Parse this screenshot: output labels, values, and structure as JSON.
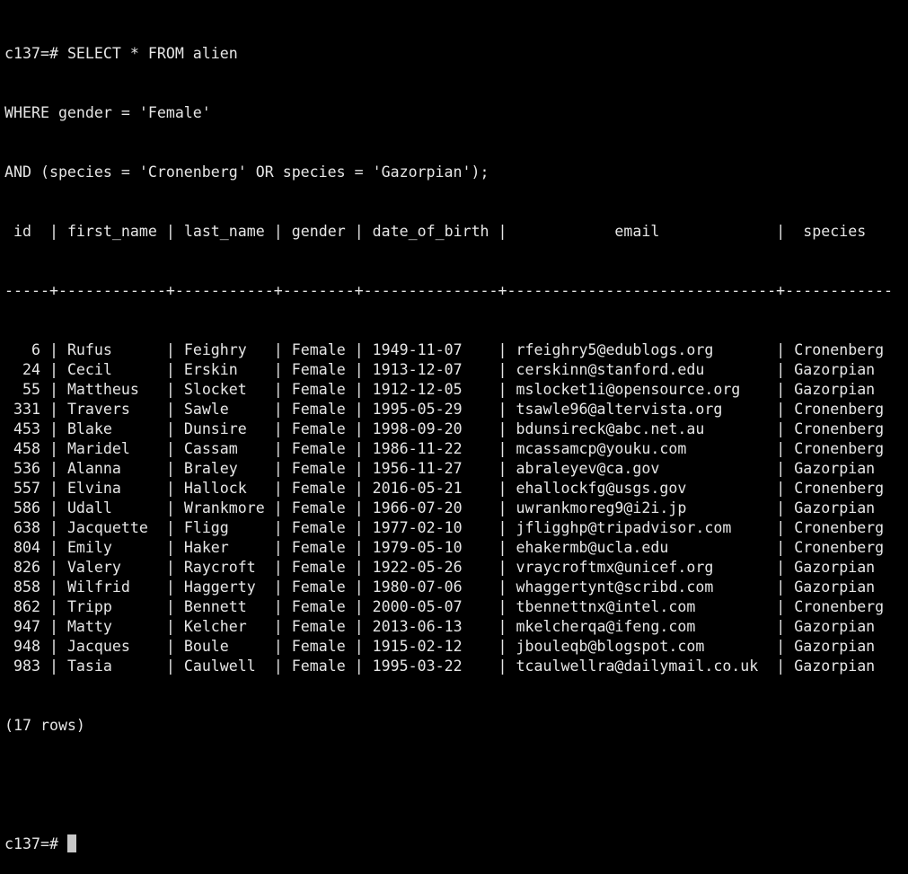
{
  "terminal": {
    "prompt": "c137=# ",
    "query_lines": [
      "SELECT * FROM alien",
      "WHERE gender = 'Female'",
      "AND (species = 'Cronenberg' OR species = 'Gazorpian');"
    ],
    "row_count_label": "(17 rows)"
  },
  "table": {
    "columns": [
      {
        "name": "id",
        "header": " id  ",
        "width": 5,
        "align": "right"
      },
      {
        "name": "first_name",
        "header": " first_name ",
        "width": 12,
        "align": "left"
      },
      {
        "name": "last_name",
        "header": " last_name ",
        "width": 11,
        "align": "left"
      },
      {
        "name": "gender",
        "header": " gender ",
        "width": 8,
        "align": "left"
      },
      {
        "name": "date_of_birth",
        "header": " date_of_birth ",
        "width": 15,
        "align": "left"
      },
      {
        "name": "email",
        "header": "            email             ",
        "width": 30,
        "align": "left"
      },
      {
        "name": "species",
        "header": "  species",
        "width": 12,
        "align": "left"
      }
    ],
    "rows": [
      {
        "id": "6",
        "first_name": "Rufus",
        "last_name": "Feighry",
        "gender": "Female",
        "date_of_birth": "1949-11-07",
        "email": "rfeighry5@edublogs.org",
        "species": "Cronenberg"
      },
      {
        "id": "24",
        "first_name": "Cecil",
        "last_name": "Erskin",
        "gender": "Female",
        "date_of_birth": "1913-12-07",
        "email": "cerskinn@stanford.edu",
        "species": "Gazorpian"
      },
      {
        "id": "55",
        "first_name": "Mattheus",
        "last_name": "Slocket",
        "gender": "Female",
        "date_of_birth": "1912-12-05",
        "email": "mslocket1i@opensource.org",
        "species": "Gazorpian"
      },
      {
        "id": "331",
        "first_name": "Travers",
        "last_name": "Sawle",
        "gender": "Female",
        "date_of_birth": "1995-05-29",
        "email": "tsawle96@altervista.org",
        "species": "Cronenberg"
      },
      {
        "id": "453",
        "first_name": "Blake",
        "last_name": "Dunsire",
        "gender": "Female",
        "date_of_birth": "1998-09-20",
        "email": "bdunsireck@abc.net.au",
        "species": "Cronenberg"
      },
      {
        "id": "458",
        "first_name": "Maridel",
        "last_name": "Cassam",
        "gender": "Female",
        "date_of_birth": "1986-11-22",
        "email": "mcassamcp@youku.com",
        "species": "Cronenberg"
      },
      {
        "id": "536",
        "first_name": "Alanna",
        "last_name": "Braley",
        "gender": "Female",
        "date_of_birth": "1956-11-27",
        "email": "abraleyev@ca.gov",
        "species": "Gazorpian"
      },
      {
        "id": "557",
        "first_name": "Elvina",
        "last_name": "Hallock",
        "gender": "Female",
        "date_of_birth": "2016-05-21",
        "email": "ehallockfg@usgs.gov",
        "species": "Cronenberg"
      },
      {
        "id": "586",
        "first_name": "Udall",
        "last_name": "Wrankmore",
        "gender": "Female",
        "date_of_birth": "1966-07-20",
        "email": "uwrankmoreg9@i2i.jp",
        "species": "Gazorpian"
      },
      {
        "id": "638",
        "first_name": "Jacquette",
        "last_name": "Fligg",
        "gender": "Female",
        "date_of_birth": "1977-02-10",
        "email": "jfligghp@tripadvisor.com",
        "species": "Cronenberg"
      },
      {
        "id": "804",
        "first_name": "Emily",
        "last_name": "Haker",
        "gender": "Female",
        "date_of_birth": "1979-05-10",
        "email": "ehakermb@ucla.edu",
        "species": "Cronenberg"
      },
      {
        "id": "826",
        "first_name": "Valery",
        "last_name": "Raycroft",
        "gender": "Female",
        "date_of_birth": "1922-05-26",
        "email": "vraycroftmx@unicef.org",
        "species": "Gazorpian"
      },
      {
        "id": "858",
        "first_name": "Wilfrid",
        "last_name": "Haggerty",
        "gender": "Female",
        "date_of_birth": "1980-07-06",
        "email": "whaggertynt@scribd.com",
        "species": "Gazorpian"
      },
      {
        "id": "862",
        "first_name": "Tripp",
        "last_name": "Bennett",
        "gender": "Female",
        "date_of_birth": "2000-05-07",
        "email": "tbennettnx@intel.com",
        "species": "Cronenberg"
      },
      {
        "id": "947",
        "first_name": "Matty",
        "last_name": "Kelcher",
        "gender": "Female",
        "date_of_birth": "2013-06-13",
        "email": "mkelcherqa@ifeng.com",
        "species": "Gazorpian"
      },
      {
        "id": "948",
        "first_name": "Jacques",
        "last_name": "Boule",
        "gender": "Female",
        "date_of_birth": "1915-02-12",
        "email": "jbouleqb@blogspot.com",
        "species": "Gazorpian"
      },
      {
        "id": "983",
        "first_name": "Tasia",
        "last_name": "Caulwell",
        "gender": "Female",
        "date_of_birth": "1995-03-22",
        "email": "tcaulwellra@dailymail.co.uk",
        "species": "Gazorpian"
      }
    ]
  }
}
